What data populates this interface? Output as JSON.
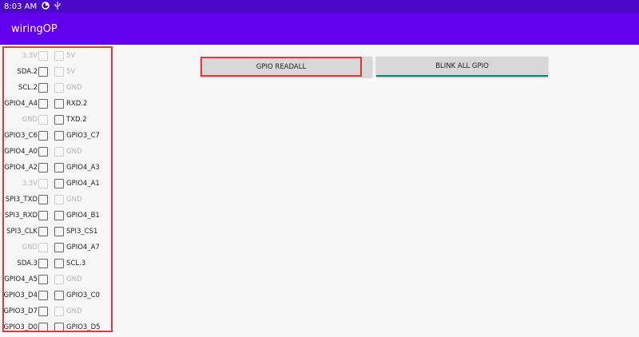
{
  "status_bar": {
    "time": "8:03 AM",
    "icons": [
      "data-saver-icon",
      "usb-icon"
    ]
  },
  "app_bar": {
    "title": "wiringOP"
  },
  "buttons": {
    "readall": "GPIO READALL",
    "blink": "BLINK ALL GPIO"
  },
  "pins": [
    {
      "left": "3.3V",
      "left_enabled": false,
      "right": "5V",
      "right_enabled": false
    },
    {
      "left": "SDA.2",
      "left_enabled": true,
      "right": "5V",
      "right_enabled": false
    },
    {
      "left": "SCL.2",
      "left_enabled": true,
      "right": "GND",
      "right_enabled": false
    },
    {
      "left": "GPIO4_A4",
      "left_enabled": true,
      "right": "RXD.2",
      "right_enabled": true
    },
    {
      "left": "GND",
      "left_enabled": false,
      "right": "TXD.2",
      "right_enabled": true
    },
    {
      "left": "GPIO3_C6",
      "left_enabled": true,
      "right": "GPIO3_C7",
      "right_enabled": true
    },
    {
      "left": "GPIO4_A0",
      "left_enabled": true,
      "right": "GND",
      "right_enabled": false
    },
    {
      "left": "GPIO4_A2",
      "left_enabled": true,
      "right": "GPIO4_A3",
      "right_enabled": true
    },
    {
      "left": "3.3V",
      "left_enabled": false,
      "right": "GPIO4_A1",
      "right_enabled": true
    },
    {
      "left": "SPI3_TXD",
      "left_enabled": true,
      "right": "GND",
      "right_enabled": false
    },
    {
      "left": "SPI3_RXD",
      "left_enabled": true,
      "right": "GPIO4_B1",
      "right_enabled": true
    },
    {
      "left": "SPI3_CLK",
      "left_enabled": true,
      "right": "SPI3_CS1",
      "right_enabled": true
    },
    {
      "left": "GND",
      "left_enabled": false,
      "right": "GPIO4_A7",
      "right_enabled": true
    },
    {
      "left": "SDA.3",
      "left_enabled": true,
      "right": "SCL.3",
      "right_enabled": true
    },
    {
      "left": "GPIO4_A5",
      "left_enabled": true,
      "right": "GND",
      "right_enabled": false
    },
    {
      "left": "GPIO3_D4",
      "left_enabled": true,
      "right": "GPIO3_C0",
      "right_enabled": true
    },
    {
      "left": "GPIO3_D7",
      "left_enabled": true,
      "right": "GND",
      "right_enabled": false
    },
    {
      "left": "GPIO3_D0",
      "left_enabled": true,
      "right": "GPIO3_D5",
      "right_enabled": true
    }
  ]
}
